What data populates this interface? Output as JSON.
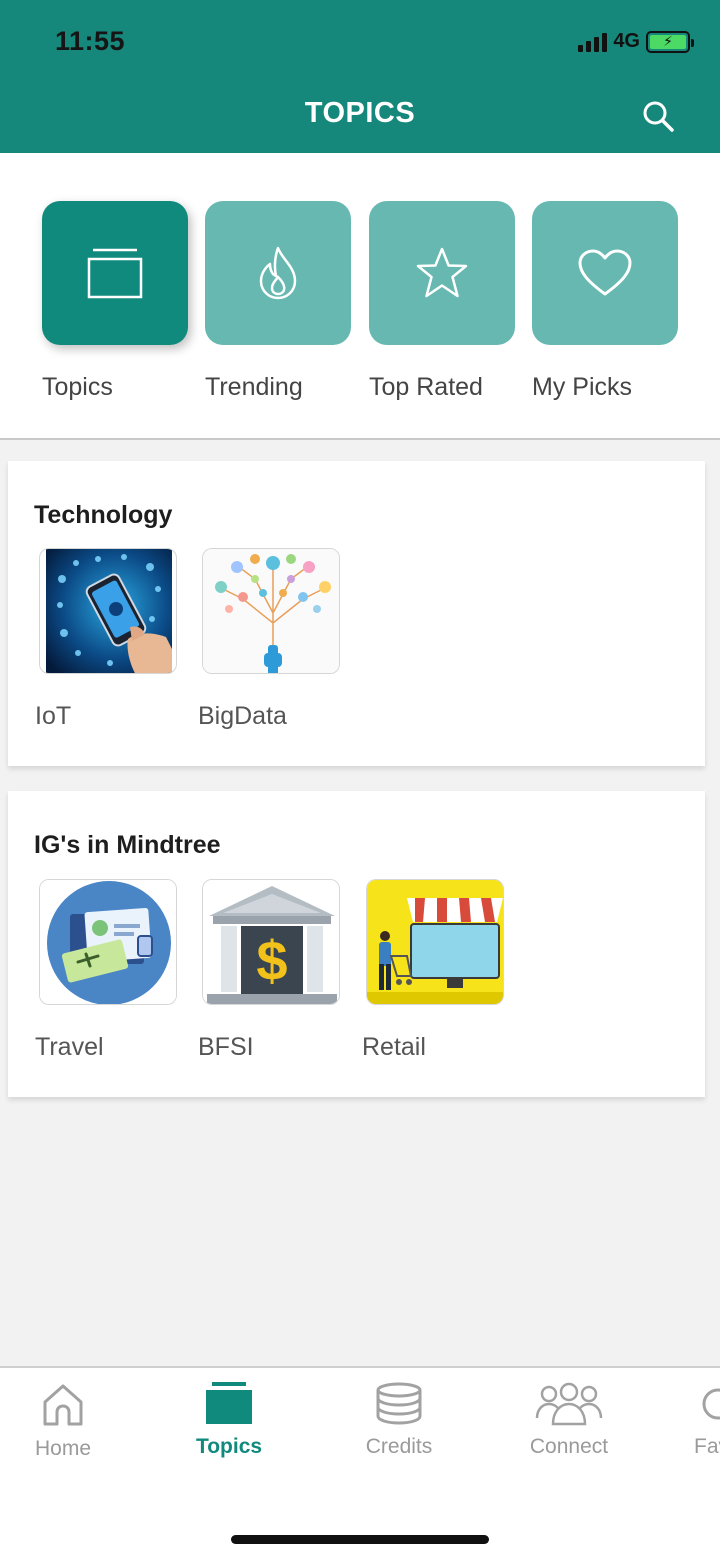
{
  "status_bar": {
    "time": "11:55",
    "network": "4G"
  },
  "header": {
    "title": "TOPICS"
  },
  "categories": [
    {
      "label": "Topics",
      "icon": "folder-icon",
      "active": true
    },
    {
      "label": "Trending",
      "icon": "flame-icon",
      "active": false
    },
    {
      "label": "Top Rated",
      "icon": "star-icon",
      "active": false
    },
    {
      "label": "My Picks",
      "icon": "heart-icon",
      "active": false
    }
  ],
  "sections": [
    {
      "title": "Technology",
      "topics": [
        {
          "name": "IoT"
        },
        {
          "name": "BigData"
        }
      ]
    },
    {
      "title": "IG's in Mindtree",
      "topics": [
        {
          "name": "Travel"
        },
        {
          "name": "BFSI"
        },
        {
          "name": "Retail"
        }
      ]
    }
  ],
  "bottom_nav": [
    {
      "label": "Home",
      "icon": "home-icon",
      "active": false
    },
    {
      "label": "Topics",
      "icon": "topics-icon",
      "active": true
    },
    {
      "label": "Credits",
      "icon": "coins-stack-icon",
      "active": false
    },
    {
      "label": "Connect",
      "icon": "people-icon",
      "active": false
    },
    {
      "label": "Fav",
      "icon": "favorites-icon",
      "active": false
    }
  ],
  "colors": {
    "primary": "#16887b",
    "tile_inactive": "#66b8b1",
    "background": "#f2f2f2"
  }
}
